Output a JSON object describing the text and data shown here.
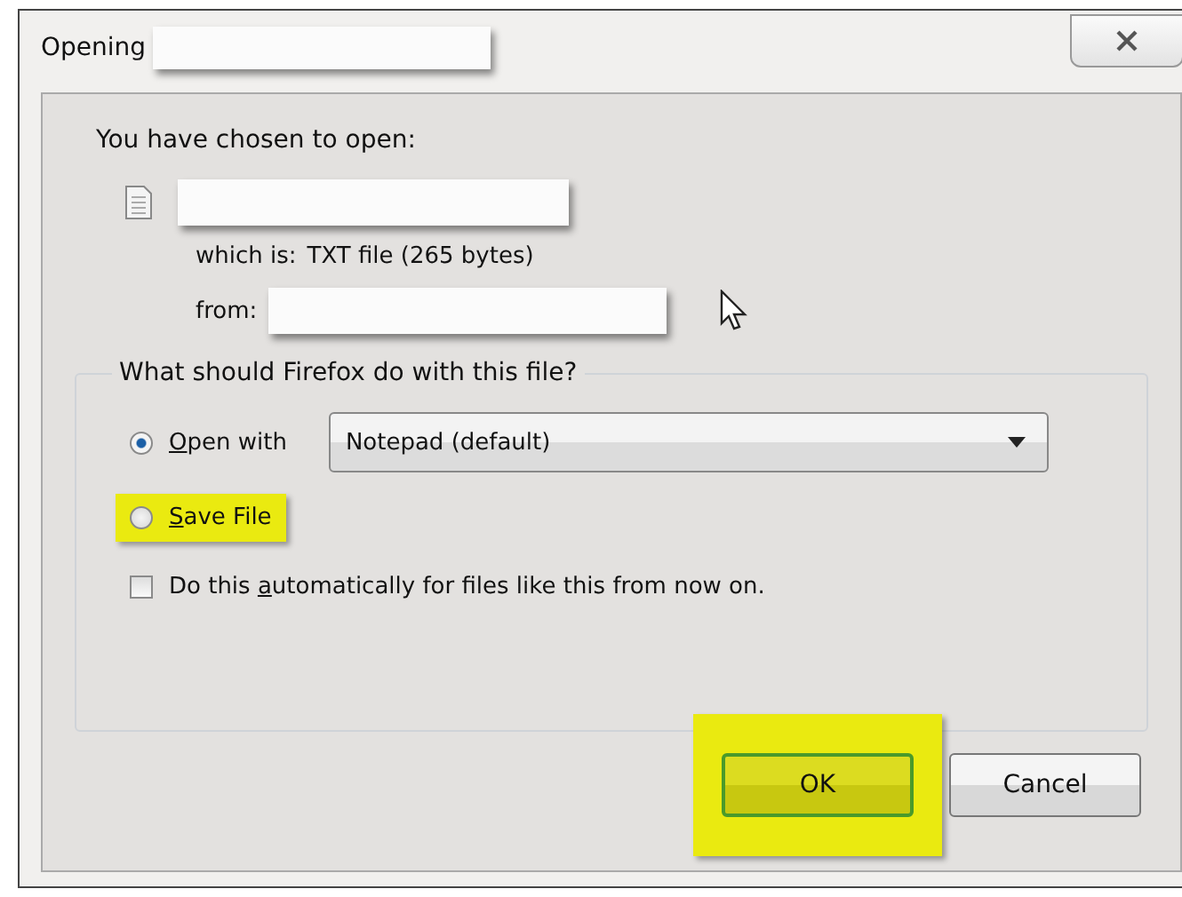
{
  "window": {
    "title": "Opening"
  },
  "intro": "You have chosen to open:",
  "file": {
    "type_label": "which is:",
    "type_value": "TXT file (265 bytes)",
    "from_label": "from:"
  },
  "group": {
    "legend": "What should Firefox do with this file?",
    "options": [
      {
        "kind": "radio",
        "label_parts": {
          "key": "O",
          "after": "pen with"
        },
        "selected": true,
        "highlighted": false,
        "dropdown_value": "Notepad (default)"
      },
      {
        "kind": "radio",
        "label_parts": {
          "key": "S",
          "after": "ave File"
        },
        "selected": false,
        "highlighted": true
      },
      {
        "kind": "checkbox",
        "label_parts": {
          "before": "Do this ",
          "key": "a",
          "after": "utomatically for files like this from now on."
        },
        "checked": false,
        "highlighted": false
      }
    ]
  },
  "buttons": [
    {
      "label": "OK",
      "default": true,
      "highlighted": true
    },
    {
      "label": "Cancel",
      "default": false,
      "highlighted": false
    }
  ]
}
